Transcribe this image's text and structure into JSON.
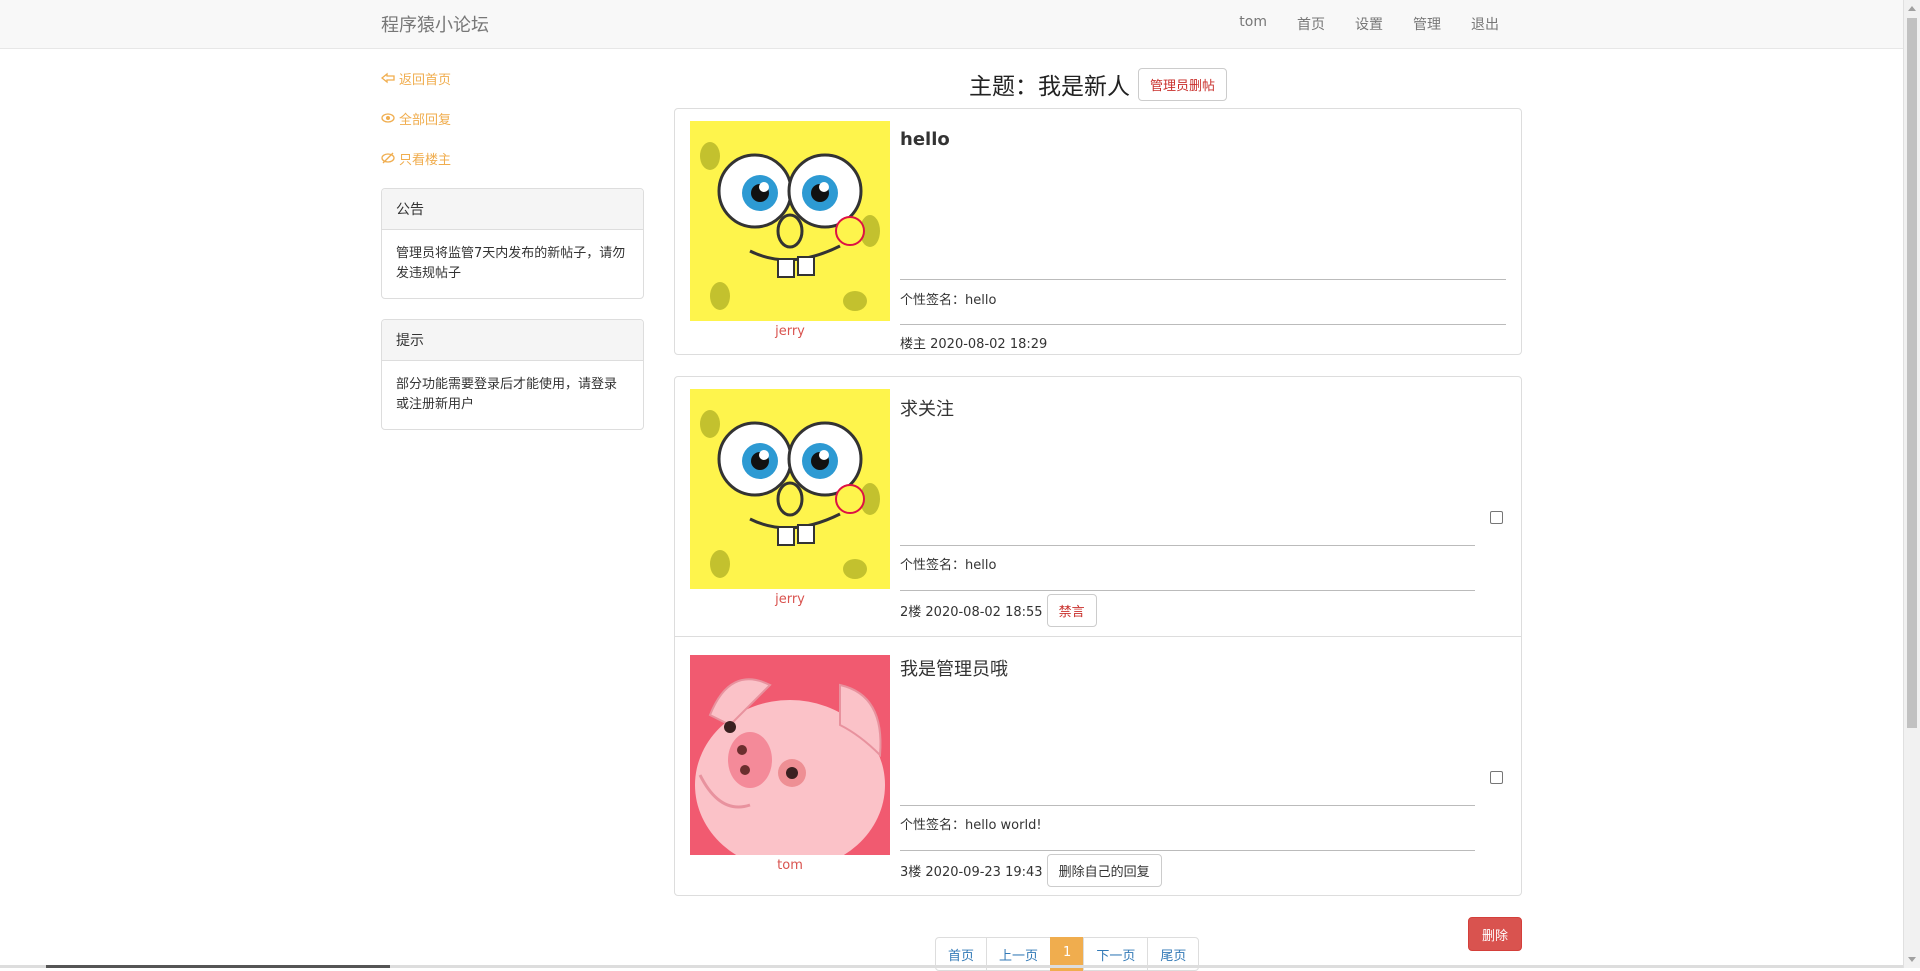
{
  "nav": {
    "brand": "程序猿小论坛",
    "links": [
      "tom",
      "首页",
      "设置",
      "管理",
      "退出"
    ]
  },
  "sidebar": {
    "links": [
      "返回首页",
      "全部回复",
      "只看楼主"
    ],
    "announcement": {
      "title": "公告",
      "body": "管理员将监管7天内发布的新帖子，请勿发违规帖子"
    },
    "tip": {
      "title": "提示",
      "body": "部分功能需要登录后才能使用，请登录或注册新用户"
    }
  },
  "topic": {
    "title": "主题：我是新人",
    "admin_delete_label": "管理员删帖"
  },
  "posts": [
    {
      "user": "jerry",
      "content": "hello",
      "signature": "个性签名：hello",
      "meta": "楼主 2020-08-02 18:29",
      "action": ""
    },
    {
      "user": "jerry",
      "content": "求关注",
      "signature": "个性签名：hello",
      "meta": "2楼 2020-08-02 18:55",
      "action": "禁言"
    },
    {
      "user": "tom",
      "content": "我是管理员哦",
      "signature": "个性签名：hello world!",
      "meta": "3楼 2020-09-23 19:43",
      "action": "删除自己的回复"
    }
  ],
  "delete_label": "删除",
  "pagination": [
    "首页",
    "上一页",
    "1",
    "下一页",
    "尾页"
  ],
  "colors": {
    "accent": "#f0ad4e",
    "danger": "#d9534f",
    "link": "#337ab7"
  }
}
